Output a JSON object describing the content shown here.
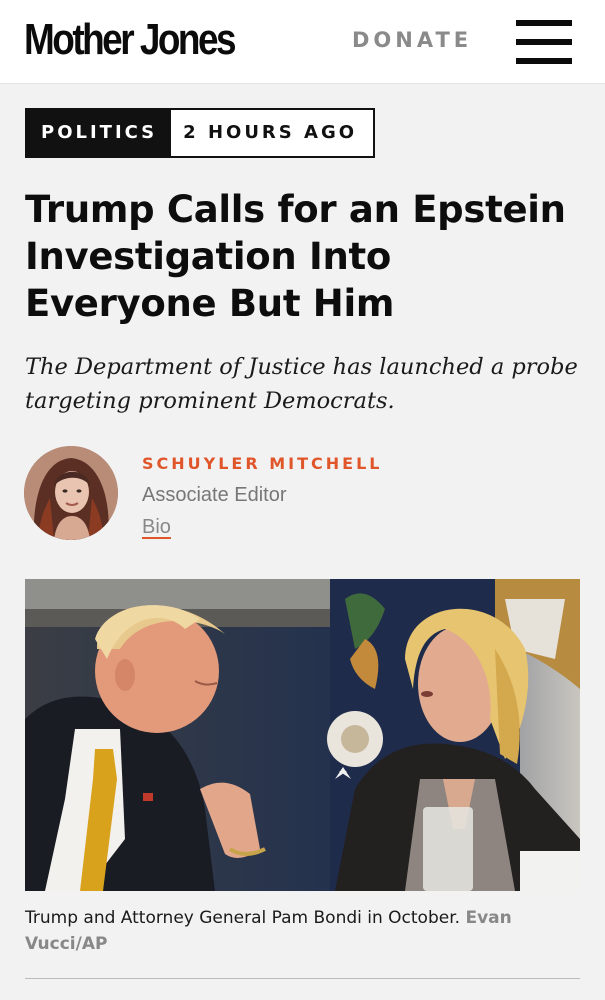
{
  "header": {
    "logo_text": "Mother Jones",
    "donate_label": "DONATE",
    "menu_icon": "hamburger-menu-icon"
  },
  "article": {
    "section": "POLITICS",
    "time_ago": "2 HOURS AGO",
    "headline": "Trump Calls for an Epstein Investigation Into Everyone But Him",
    "dek": "The Department of Justice has launched a probe targeting prominent Democrats.",
    "author": {
      "name": "SCHUYLER MITCHELL",
      "title": "Associate Editor",
      "bio_link": "Bio"
    },
    "photo": {
      "caption": "Trump and Attorney General Pam Bondi in October.",
      "credit": "Evan Vucci/AP"
    }
  },
  "colors": {
    "accent": "#e0562a",
    "text": "#111111",
    "muted": "#888888",
    "background": "#f2f2f2"
  }
}
